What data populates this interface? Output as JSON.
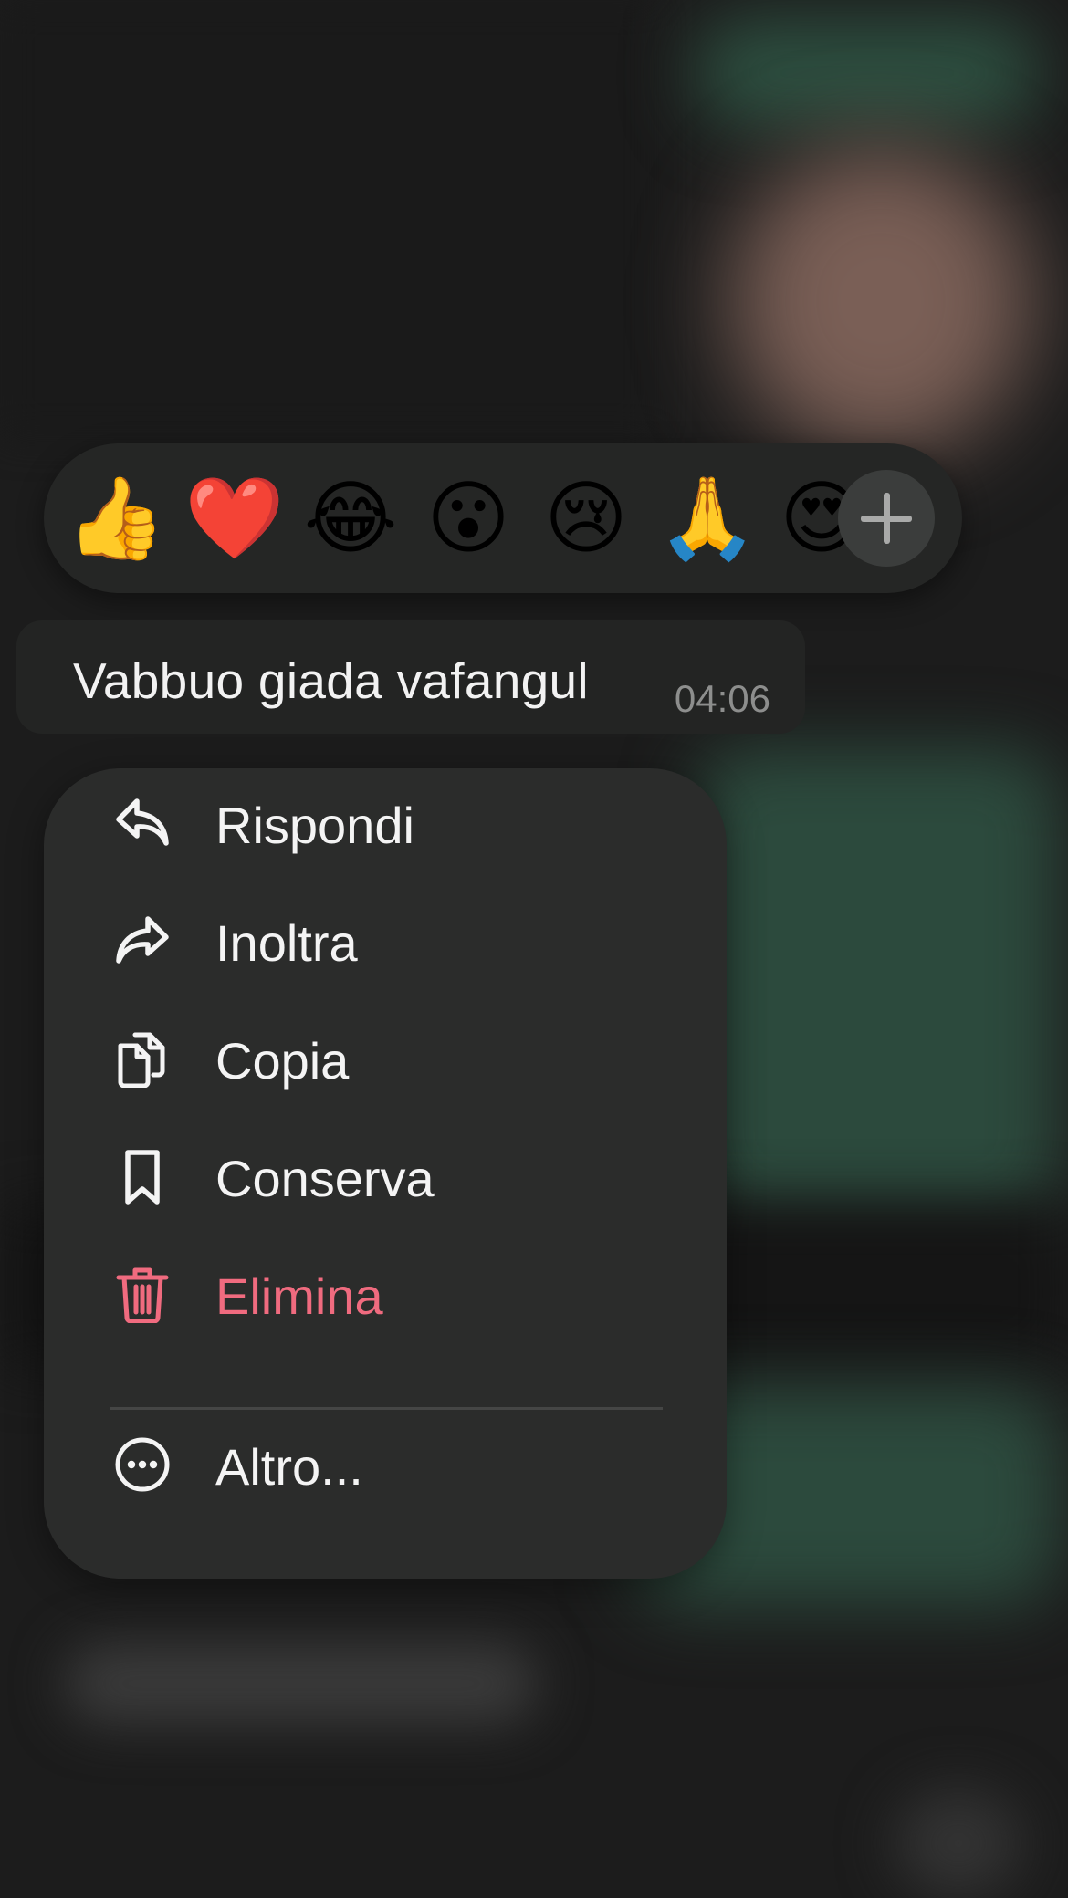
{
  "reactions": {
    "emojis": [
      "👍",
      "❤️",
      "😂",
      "😮",
      "😢",
      "🙏",
      "😍"
    ],
    "more_icon": "plus-icon"
  },
  "message": {
    "text": "Vabbuo giada vafangul",
    "time": "04:06"
  },
  "menu": {
    "items": [
      {
        "label": "Rispondi",
        "icon": "reply-icon"
      },
      {
        "label": "Inoltra",
        "icon": "forward-icon"
      },
      {
        "label": "Copia",
        "icon": "copy-icon"
      },
      {
        "label": "Conserva",
        "icon": "bookmark-icon"
      },
      {
        "label": "Elimina",
        "icon": "trash-icon"
      },
      {
        "label": "Altro...",
        "icon": "more-icon"
      }
    ]
  },
  "colors": {
    "danger": "#f06b7f",
    "menu_bg": "#2b2c2b",
    "text": "#f4f4f4"
  }
}
